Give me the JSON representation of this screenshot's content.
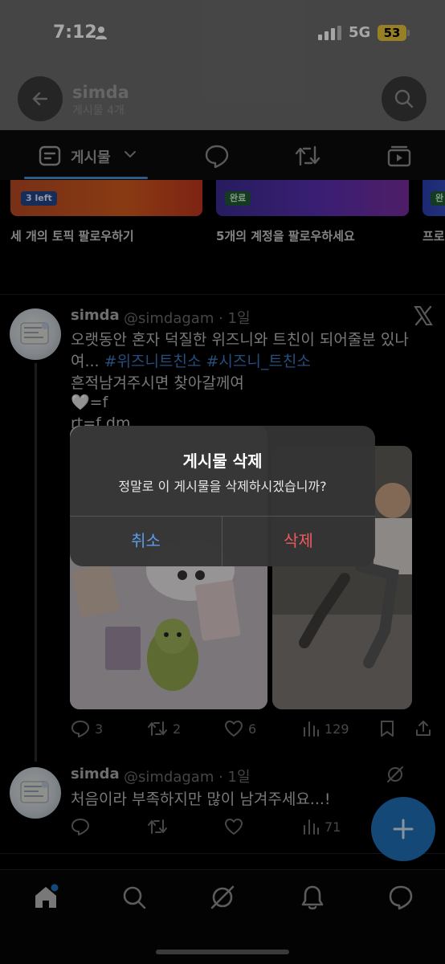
{
  "status_bar": {
    "time": "7:12",
    "network": "5G",
    "battery": "53"
  },
  "header": {
    "name": "simda",
    "subtitle": "게시물 4개"
  },
  "tabs": [
    {
      "label": "게시물"
    }
  ],
  "topic_cards": [
    {
      "badge": "3 left",
      "caption": "세 개의 토픽 팔로우하기"
    },
    {
      "badge": "완료",
      "caption": "5개의 계정을 팔로우하세요"
    },
    {
      "badge": "완",
      "caption": "프로"
    }
  ],
  "tweet1": {
    "name": "simda",
    "handle": "@simdagam · 1일",
    "line1": "오랫동안 혼자 덕질한 위즈니와 트친이 되어줄분 있나",
    "line2_prefix": "여... ",
    "hashtag1": "#위즈니트친소",
    "hashtag2": "#시즈니_트친소",
    "line3": "흔적남겨주시면 찾아갈께여",
    "line4": "🤍=f",
    "line5": "rt=f dm",
    "replies": "3",
    "retweets": "2",
    "likes": "6",
    "views": "129"
  },
  "tweet2": {
    "name": "simda",
    "handle": "@simdagam · 1일",
    "text": "처음이라 부족하지만 많이 남겨주세요...!",
    "views": "71"
  },
  "dialog": {
    "title": "게시물 삭제",
    "message": "정말로 이 게시물을 삭제하시겠습니까?",
    "cancel": "취소",
    "delete": "삭제"
  },
  "colors": {
    "accent": "#3b82d6",
    "destructive": "#e5484d",
    "dialog_bg": "#343434"
  }
}
